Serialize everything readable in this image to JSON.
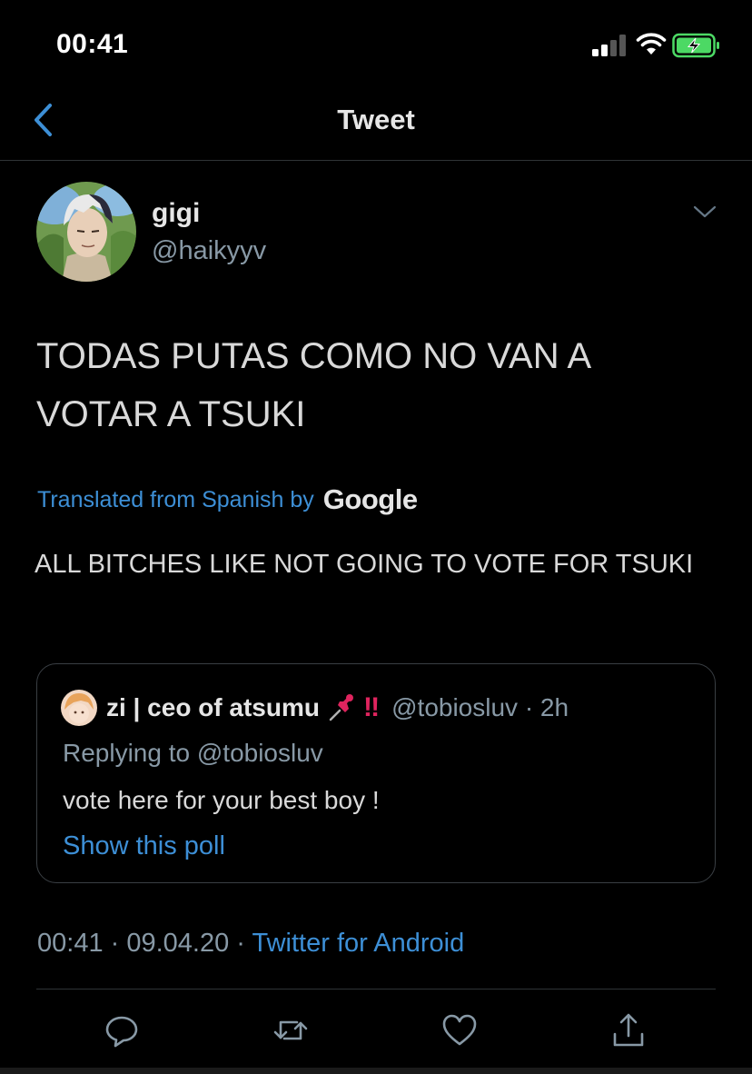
{
  "status_bar": {
    "time": "00:41"
  },
  "nav": {
    "title": "Tweet"
  },
  "author": {
    "display_name": "gigi",
    "handle": "@haikyyv"
  },
  "tweet": {
    "text": "TODAS PUTAS COMO NO VAN A VOTAR A TSUKI",
    "translated_label": "Translated from Spanish by",
    "translation_provider": "Google",
    "translation": "ALL BITCHES LIKE NOT GOING TO VOTE FOR TSUKI"
  },
  "quote": {
    "display_name": "zi | ceo of atsumu",
    "badge": "‼",
    "handle_time": "@tobiosluv · 2h",
    "replying": "Replying to @tobiosluv",
    "text": "vote here for your best boy !",
    "poll_link": "Show this poll"
  },
  "meta": {
    "time": "00:41",
    "separator1": " · ",
    "date": "09.04.20",
    "separator2": " · ",
    "source": "Twitter for Android"
  },
  "icons": [
    "chevron-left-icon",
    "chevron-down-icon",
    "reply-icon",
    "retweet-icon",
    "like-icon",
    "share-icon",
    "pushpin-icon"
  ],
  "colors": {
    "background": "#000000",
    "link": "#3d8fd6",
    "muted": "#8899a6",
    "alert": "#e0245e",
    "battery": "#4cd964"
  }
}
